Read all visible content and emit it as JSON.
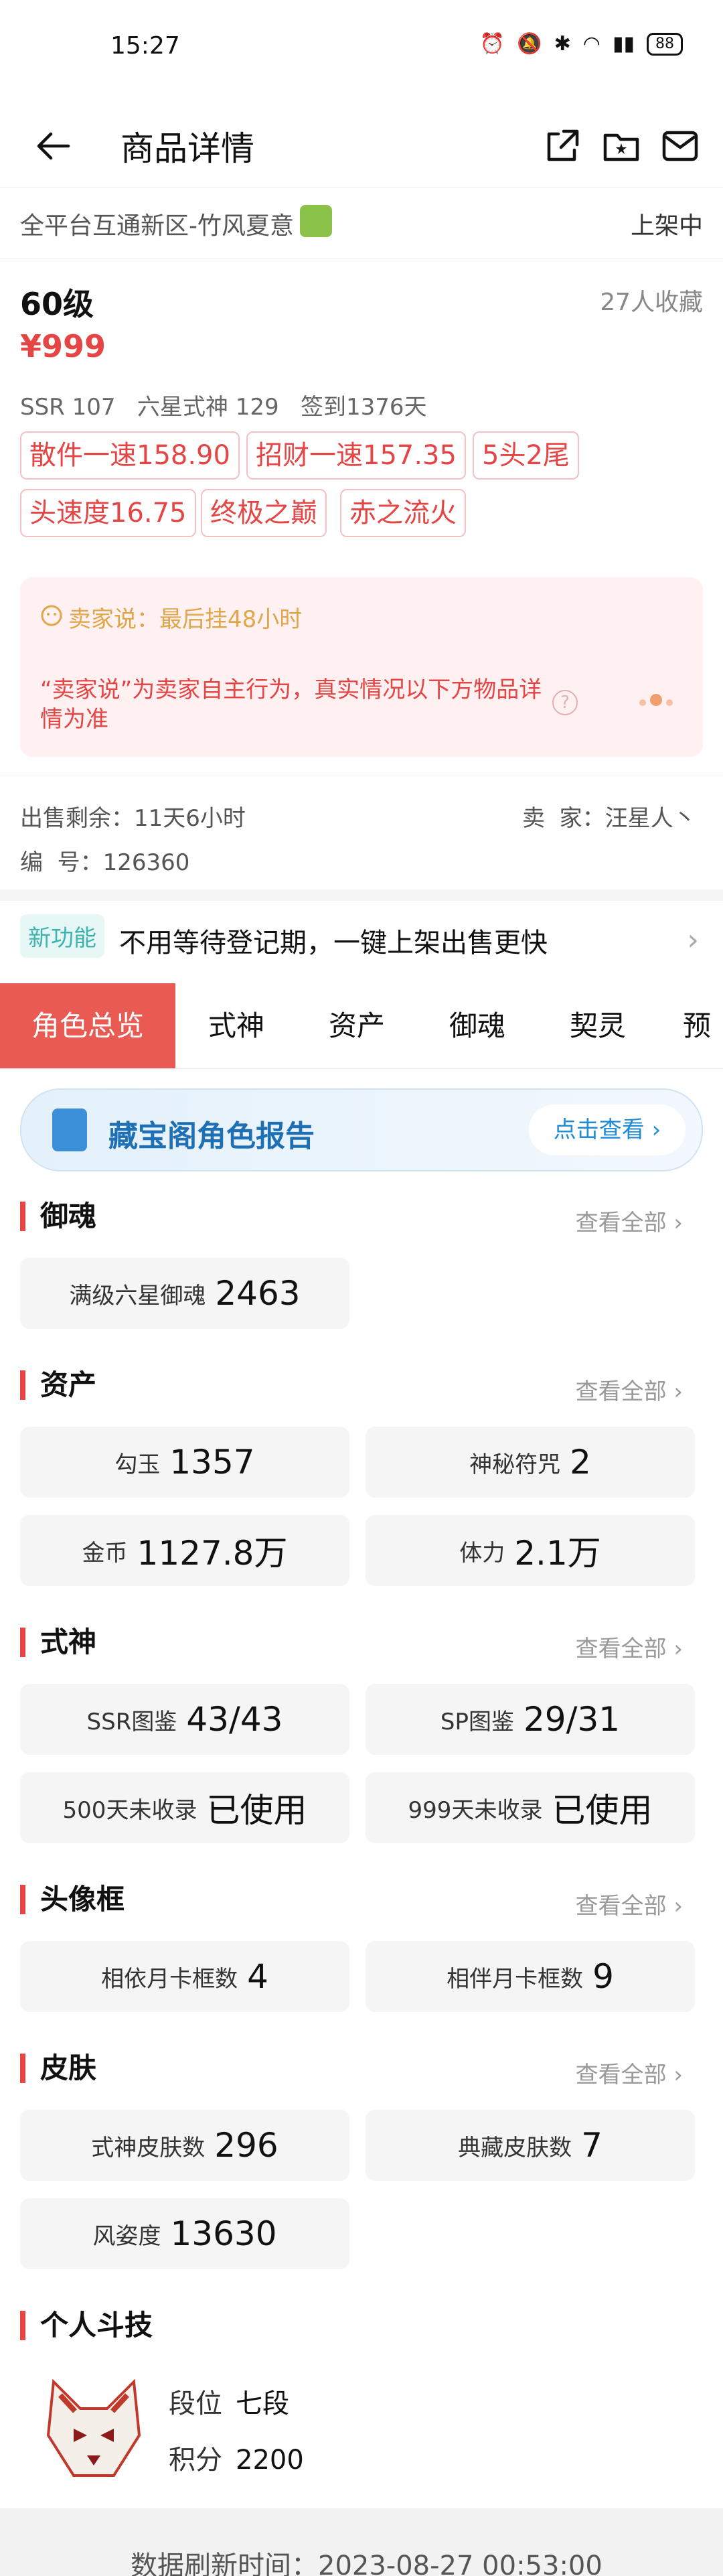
{
  "status_bar": {
    "time": "15:27",
    "battery": "88"
  },
  "nav": {
    "title": "商品详情"
  },
  "listing": {
    "server": "全平台互通新区-竹风夏意",
    "status": "上架中",
    "level": "60级",
    "favorites": "27人收藏",
    "price": "¥999",
    "stats": "SSR 107   六星式神 129   签到1376天",
    "tags": [
      "散件一速158.90",
      "招财一速157.35",
      "5头2尾",
      "头速度16.75",
      "终极之巅",
      "赤之流火"
    ]
  },
  "seller_box": {
    "title": "卖家说：最后挂48小时",
    "note": "“卖家说”为卖家自主行为，真实情况以下方物品详情为准"
  },
  "meta": {
    "time_left": "出售剩余：11天6小时",
    "seller": "卖  家：汪星人丶",
    "serial": "编  号：126360"
  },
  "new_feature": {
    "badge": "新功能",
    "text": "不用等待登记期，一键上架出售更快"
  },
  "tabs": [
    "角色总览",
    "式神",
    "资产",
    "御魂",
    "契灵",
    "预"
  ],
  "report": {
    "title": "藏宝阁角色报告",
    "button": "点击查看 ›"
  },
  "see_all": "查看全部 ›",
  "sections": {
    "yuhun": {
      "title": "御魂",
      "cards": [
        {
          "k": "满级六星御魂",
          "v": "2463"
        }
      ]
    },
    "assets": {
      "title": "资产",
      "cards": [
        {
          "k": "勾玉",
          "v": "1357"
        },
        {
          "k": "神秘符咒",
          "v": "2"
        },
        {
          "k": "金币",
          "v": "1127.8万"
        },
        {
          "k": "体力",
          "v": "2.1万"
        }
      ]
    },
    "shikigami": {
      "title": "式神",
      "cards": [
        {
          "k": "SSR图鉴",
          "v": "43/43"
        },
        {
          "k": "SP图鉴",
          "v": "29/31"
        },
        {
          "k": "500天未收录",
          "v": "已使用"
        },
        {
          "k": "999天未收录",
          "v": "已使用"
        }
      ]
    },
    "frames": {
      "title": "头像框",
      "cards": [
        {
          "k": "相依月卡框数",
          "v": "4"
        },
        {
          "k": "相伴月卡框数",
          "v": "9"
        }
      ]
    },
    "skins": {
      "title": "皮肤",
      "cards": [
        {
          "k": "式神皮肤数",
          "v": "296"
        },
        {
          "k": "典藏皮肤数",
          "v": "7"
        },
        {
          "k": "风姿度",
          "v": "13630"
        }
      ]
    },
    "pvp": {
      "title": "个人斗技",
      "rank_label": "段位",
      "rank": "七段",
      "score_label": "积分",
      "score": "2200"
    }
  },
  "footer": {
    "text": "数据刷新时间：2023-08-27 00:53:00"
  }
}
